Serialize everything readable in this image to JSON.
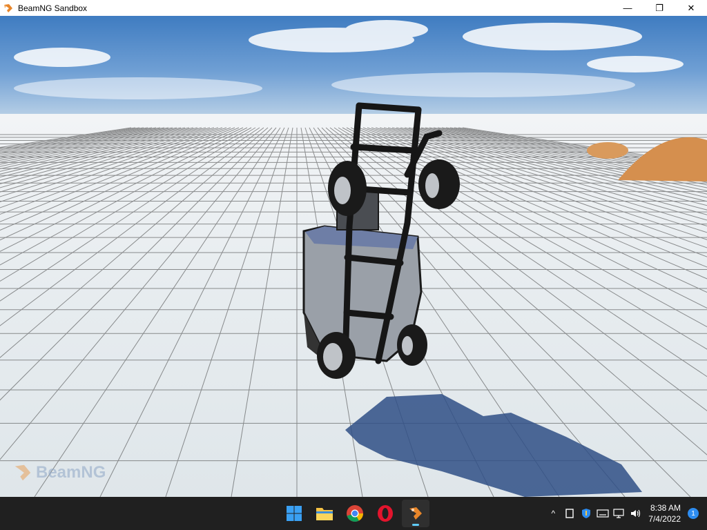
{
  "window": {
    "title": "BeamNG Sandbox",
    "controls": {
      "minimize": "—",
      "maximize": "❐",
      "close": "✕"
    }
  },
  "viewport": {
    "watermark": "BeamNG"
  },
  "taskbar": {
    "apps": [
      {
        "name": "start-icon"
      },
      {
        "name": "file-explorer-icon"
      },
      {
        "name": "chrome-icon"
      },
      {
        "name": "opera-icon"
      },
      {
        "name": "beamng-icon",
        "active": true
      }
    ],
    "tray": {
      "chevron": "^",
      "time": "8:38 AM",
      "date": "7/4/2022",
      "notifications": "1"
    }
  },
  "colors": {
    "taskbar_bg": "#202020",
    "accent": "#60cdff",
    "sky": "#3f7cc1"
  }
}
